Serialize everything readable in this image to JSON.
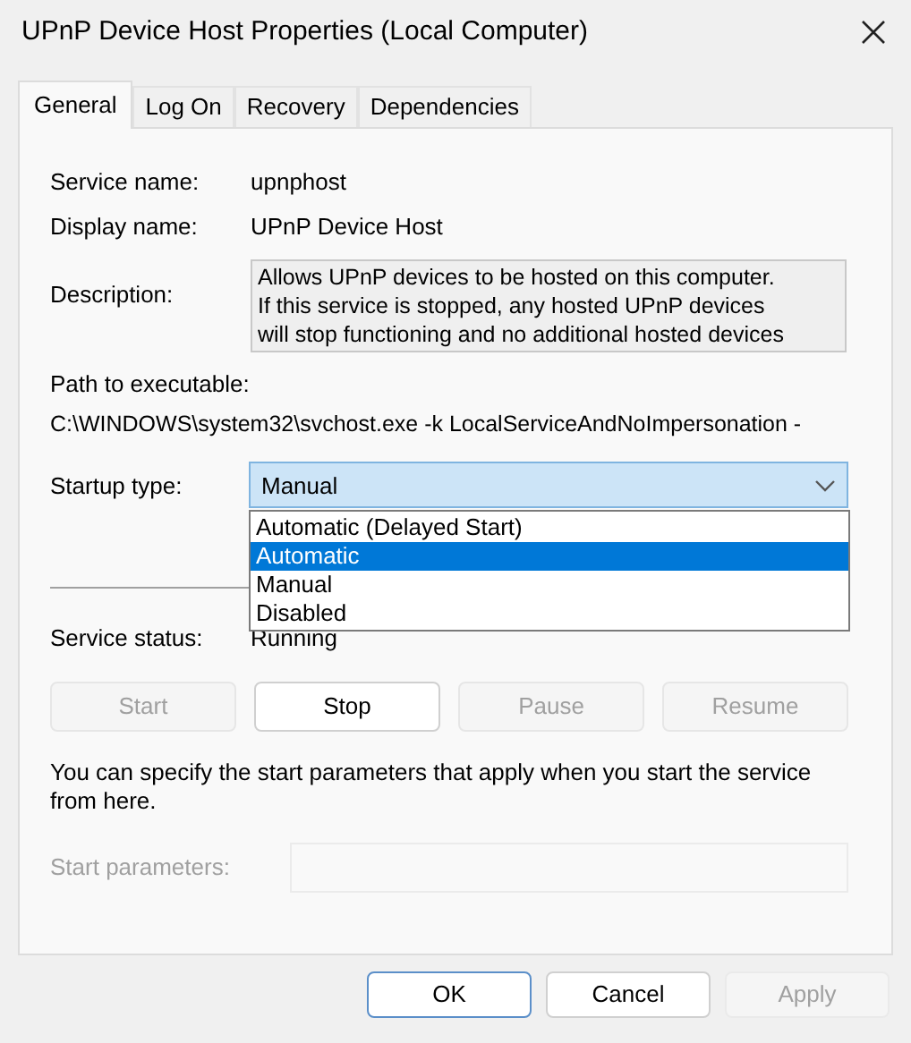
{
  "window": {
    "title": "UPnP Device Host Properties (Local Computer)"
  },
  "tabs": [
    {
      "label": "General",
      "selected": true
    },
    {
      "label": "Log On",
      "selected": false
    },
    {
      "label": "Recovery",
      "selected": false
    },
    {
      "label": "Dependencies",
      "selected": false
    }
  ],
  "fields": [
    {
      "label": "Service name:",
      "value": "upnphost"
    },
    {
      "label": "Display name:",
      "value": "UPnP Device Host"
    }
  ],
  "description": {
    "label": "Description:",
    "lines": [
      "Allows UPnP devices to be hosted on this computer.",
      "If this service is stopped, any hosted UPnP devices",
      "will stop functioning and no additional hosted devices"
    ]
  },
  "path": {
    "label": "Path to executable:",
    "value": "C:\\WINDOWS\\system32\\svchost.exe -k LocalServiceAndNoImpersonation -"
  },
  "startup_type": {
    "label": "Startup type:",
    "value": "Manual",
    "expanded": true,
    "options": [
      {
        "label": "Automatic (Delayed Start)",
        "highlighted": false
      },
      {
        "label": "Automatic",
        "highlighted": true
      },
      {
        "label": "Manual",
        "highlighted": false
      },
      {
        "label": "Disabled",
        "highlighted": false
      }
    ]
  },
  "service_status": {
    "label": "Service status:",
    "value": "Running"
  },
  "service_buttons": [
    {
      "label": "Start",
      "disabled": true
    },
    {
      "label": "Stop",
      "disabled": false
    },
    {
      "label": "Pause",
      "disabled": true
    },
    {
      "label": "Resume",
      "disabled": true
    }
  ],
  "hint": "You can specify the start parameters that apply when you start the service from here.",
  "start_parameters": {
    "label": "Start parameters:",
    "disabled": true
  },
  "dialog_buttons": [
    {
      "label": "OK",
      "disabled": false,
      "default": true
    },
    {
      "label": "Cancel",
      "disabled": false,
      "default": false
    },
    {
      "label": "Apply",
      "disabled": true,
      "default": false
    }
  ]
}
